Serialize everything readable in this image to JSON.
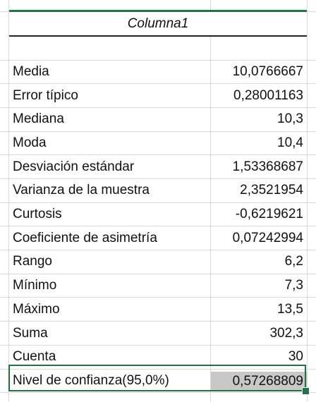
{
  "table": {
    "header": "Columna1",
    "rows": [
      {
        "label": "Media",
        "value": "10,0766667"
      },
      {
        "label": "Error típico",
        "value": "0,28001163"
      },
      {
        "label": "Mediana",
        "value": "10,3"
      },
      {
        "label": "Moda",
        "value": "10,4"
      },
      {
        "label": "Desviación estándar",
        "value": "1,53368687"
      },
      {
        "label": "Varianza de la muestra",
        "value": "2,3521954"
      },
      {
        "label": "Curtosis",
        "value": "-0,6219621"
      },
      {
        "label": "Coeficiente de asimetría",
        "value": "0,07242994"
      },
      {
        "label": "Rango",
        "value": "6,2"
      },
      {
        "label": "Mínimo",
        "value": "7,3"
      },
      {
        "label": "Máximo",
        "value": "13,5"
      },
      {
        "label": "Suma",
        "value": "302,3"
      },
      {
        "label": "Cuenta",
        "value": "30"
      },
      {
        "label": "Nivel de confianza(95,0%)",
        "value": "0,57268809"
      }
    ]
  },
  "colors": {
    "selection": "#217346"
  }
}
